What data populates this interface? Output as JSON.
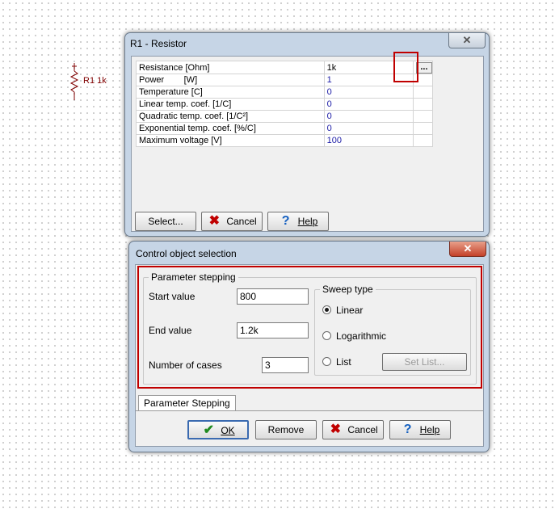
{
  "schematic": {
    "label": "R1 1k"
  },
  "resistor_dialog": {
    "title": "R1 - Resistor",
    "close_glyph": "✕",
    "properties": [
      {
        "name": "Resistance [Ohm]",
        "value": "1k"
      },
      {
        "name": "Power        [W]",
        "value": "1"
      },
      {
        "name": "Temperature [C]",
        "value": "0"
      },
      {
        "name": "Linear temp. coef. [1/C]",
        "value": "0"
      },
      {
        "name": "Quadratic temp. coef. [1/C²]",
        "value": "0"
      },
      {
        "name": "Exponential temp. coef. [%/C]",
        "value": "0"
      },
      {
        "name": "Maximum voltage [V]",
        "value": "100"
      }
    ],
    "dots_label": "...",
    "buttons": {
      "select": "Select...",
      "cancel": "Cancel",
      "help": "Help"
    }
  },
  "control_dialog": {
    "title": "Control object selection",
    "close_glyph": "✕",
    "param_group_title": "Parameter stepping",
    "start_label": "Start value",
    "start_value": "800",
    "end_label": "End value",
    "end_value": "1.2k",
    "cases_label": "Number of cases",
    "cases_value": "3",
    "sweep_group_title": "Sweep type",
    "sweep_options": [
      {
        "label": "Linear",
        "selected": true
      },
      {
        "label": "Logarithmic",
        "selected": false
      },
      {
        "label": "List",
        "selected": false
      }
    ],
    "set_list_label": "Set List...",
    "tab_label": "Parameter Stepping",
    "buttons": {
      "ok": "OK",
      "remove": "Remove",
      "cancel": "Cancel",
      "help": "Help"
    }
  },
  "icons": {
    "close": "close-icon",
    "cancel": "cancel-x-icon",
    "help": "help-question-icon",
    "ok": "checkmark-icon",
    "resistor": "resistor-symbol-icon"
  },
  "colors": {
    "highlight": "#c00000",
    "value_text": "#1a1aa6",
    "schematic": "#800000"
  }
}
